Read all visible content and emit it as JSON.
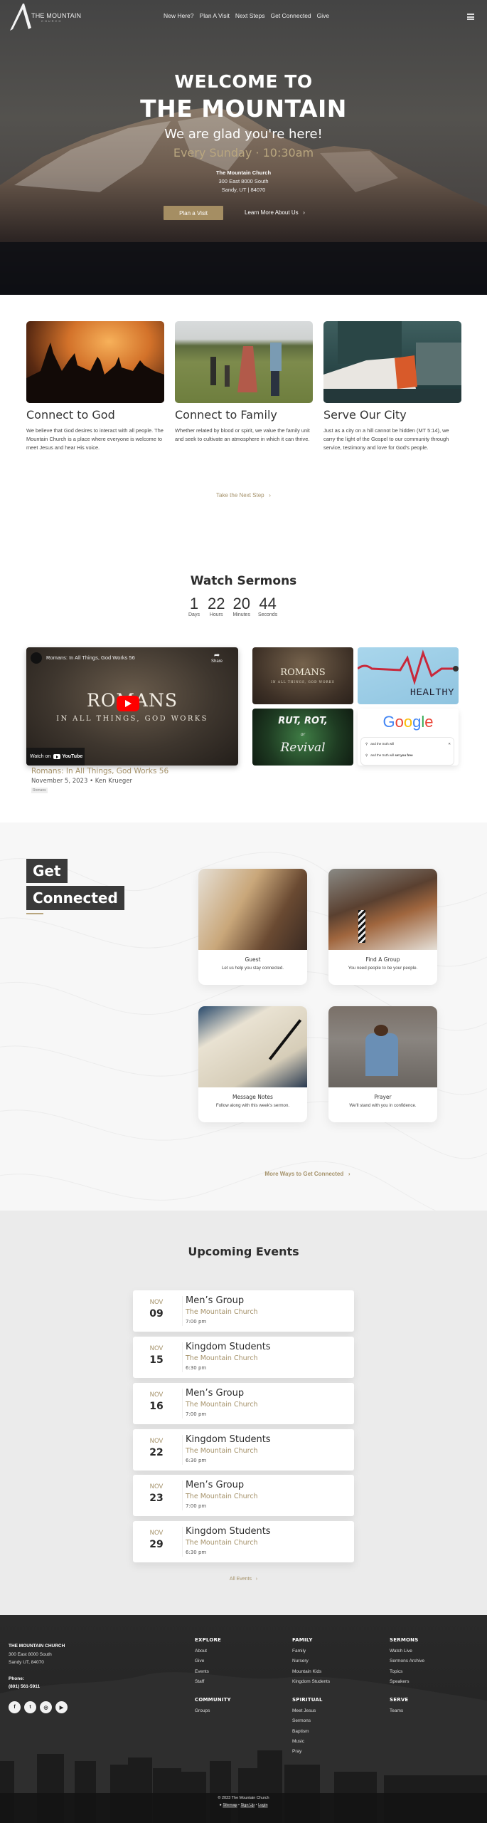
{
  "nav": {
    "logo_text": "THE MOUNTAIN",
    "logo_sub": "CHURCH",
    "links": [
      "New Here?",
      "Plan A Visit",
      "Next Steps",
      "Get Connected",
      "Give"
    ],
    "menu_icon": "hamburger-icon"
  },
  "hero": {
    "welcome": "WELCOME TO",
    "mountain": "THE MOUNTAIN",
    "glad": "We are glad you're here!",
    "service_time": "Every Sunday · 10:30am",
    "church_name": "The Mountain Church",
    "address_line1": "300 East 8000 South",
    "address_line2": "Sandy, UT | 84070",
    "plan_visit_label": "Plan a Visit",
    "learn_more_label": "Learn More About Us",
    "accent_color": "#a58e63"
  },
  "connect": {
    "cards": [
      {
        "title": "Connect to God",
        "text": "We believe that God desires to interact with all people. The Mountain Church is a place where everyone is welcome to meet Jesus and hear His voice."
      },
      {
        "title": "Connect to Family",
        "text": "Whether related by blood or spirit, we value the family unit and seek to cultivate an atmosphere in which it can thrive."
      },
      {
        "title": "Serve Our City",
        "text": "Just as a city on a hill cannot be hidden (MT 5:14), we carry the light of the Gospel to our community through service, testimony and love for God's people."
      }
    ],
    "next_step_label": "Take the Next Step"
  },
  "sermons": {
    "title": "Watch Sermons",
    "countdown": [
      {
        "value": "1",
        "label": "Days"
      },
      {
        "value": "22",
        "label": "Hours"
      },
      {
        "value": "20",
        "label": "Minutes"
      },
      {
        "value": "44",
        "label": "Seconds"
      }
    ],
    "video": {
      "title": "Romans: In All Things, God Works 56",
      "share_label": "Share",
      "overlay_title": "ROMANS",
      "overlay_sub": "IN ALL THINGS, GOD WORKS",
      "watch_on": "Watch on",
      "youtube": "YouTube"
    },
    "featured": {
      "title": "Romans: In All Things, God Works 56",
      "meta": "November 5, 2023 • Ken Krueger",
      "tag": "Romans"
    },
    "thumbs": {
      "romans_title": "ROMANS",
      "romans_sub": "IN ALL THINGS, GOD WORKS",
      "healthy": "HEALTHY",
      "rut": "RUT, ROT,",
      "or": "or",
      "revival": "Revival",
      "google": "Google",
      "search_query": "and the truth will",
      "search_suggestion_prefix": "and the truth will",
      "search_suggestion_bold": "set you free"
    }
  },
  "get_connected": {
    "title_line1": "Get",
    "title_line2": "Connected",
    "cards": [
      {
        "title": "Guest",
        "text": "Let us help you stay connected."
      },
      {
        "title": "Find A Group",
        "text": "You need people to be your people."
      },
      {
        "title": "Message Notes",
        "text": "Follow along with this week's sermon."
      },
      {
        "title": "Prayer",
        "text": "We'll stand with you in confidence."
      }
    ],
    "more_label": "More Ways to Get Connected"
  },
  "events": {
    "title": "Upcoming Events",
    "items": [
      {
        "month": "NOV",
        "day": "09",
        "name": "Men’s Group",
        "location": "The Mountain Church",
        "time": "7:00 pm"
      },
      {
        "month": "NOV",
        "day": "15",
        "name": "Kingdom Students",
        "location": "The Mountain Church",
        "time": "6:30 pm"
      },
      {
        "month": "NOV",
        "day": "16",
        "name": "Men’s Group",
        "location": "The Mountain Church",
        "time": "7:00 pm"
      },
      {
        "month": "NOV",
        "day": "22",
        "name": "Kingdom Students",
        "location": "The Mountain Church",
        "time": "6:30 pm"
      },
      {
        "month": "NOV",
        "day": "23",
        "name": "Men’s Group",
        "location": "The Mountain Church",
        "time": "7:00 pm"
      },
      {
        "month": "NOV",
        "day": "29",
        "name": "Kingdom Students",
        "location": "The Mountain Church",
        "time": "6:30 pm"
      }
    ],
    "all_label": "All Events"
  },
  "footer": {
    "name": "THE MOUNTAIN CHURCH",
    "address_line1": "300 East 8000 South",
    "address_line2": "Sandy UT, 84070",
    "phone_label": "Phone:",
    "phone": "(801) 561-5911",
    "socials": [
      "facebook",
      "twitter",
      "instagram",
      "youtube"
    ],
    "columns": [
      {
        "heading": "EXPLORE",
        "links": [
          "About",
          "Give",
          "Events",
          "Staff"
        ]
      },
      {
        "heading": "FAMILY",
        "links": [
          "Family",
          "Nursery",
          "Mountain Kids",
          "Kingdom Students"
        ]
      },
      {
        "heading": "SERMONS",
        "links": [
          "Watch Live",
          "Sermons Archive",
          "Topics",
          "Speakers"
        ]
      },
      {
        "heading": "COMMUNITY",
        "links": [
          "Groups"
        ]
      },
      {
        "heading": "SPIRITUAL",
        "links": [
          "Meet Jesus",
          "Sermons",
          "Baptism",
          "Music",
          "Pray"
        ]
      },
      {
        "heading": "SERVE",
        "links": [
          "Teams"
        ]
      }
    ],
    "copyright": "© 2023 The Mountain Church",
    "legal": [
      "Sitemap",
      "Sign Up",
      "Login"
    ]
  }
}
